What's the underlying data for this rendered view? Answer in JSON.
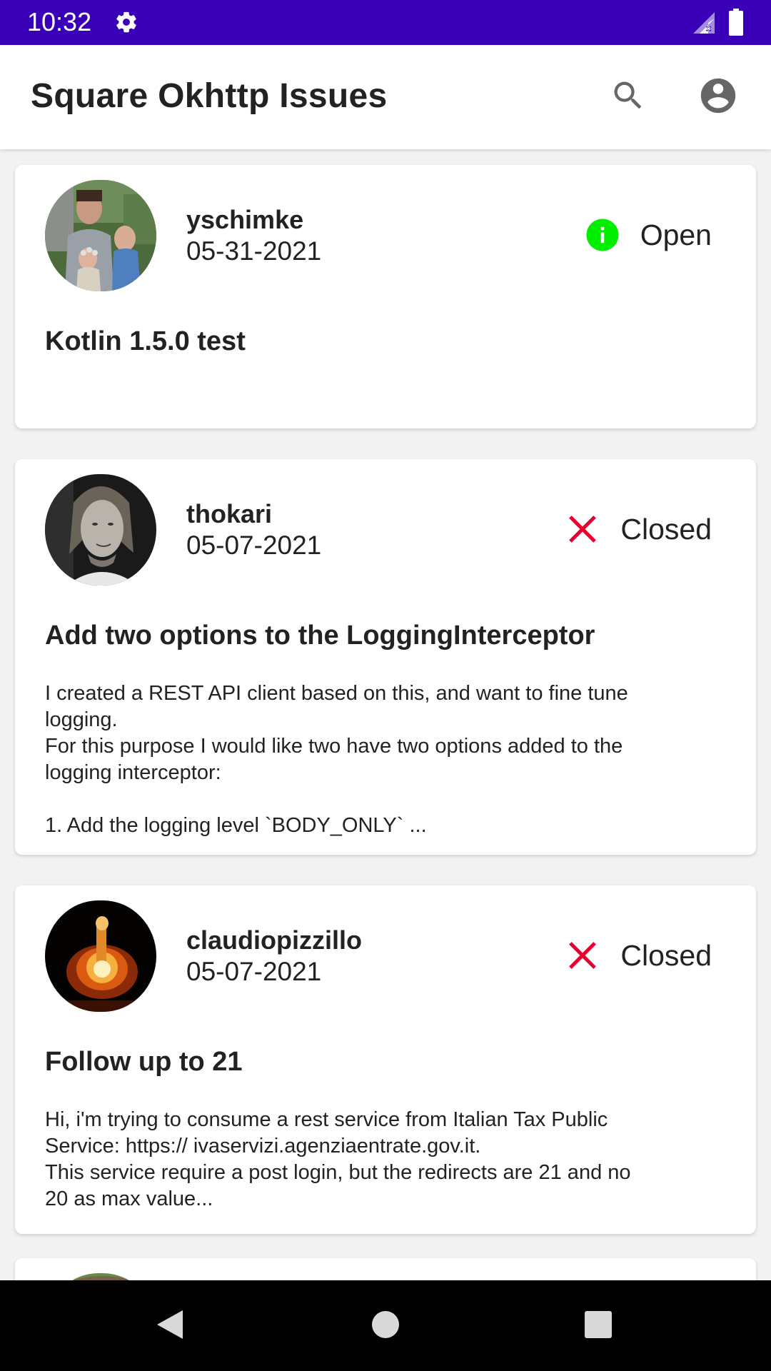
{
  "status_bar": {
    "time": "10:32",
    "icons": [
      "settings-gear-icon",
      "signal-icon",
      "battery-icon"
    ]
  },
  "app_bar": {
    "title": "Square Okhttp Issues",
    "actions": [
      "search-icon",
      "account-circle-icon"
    ]
  },
  "colors": {
    "status_bar": "#3a00b8",
    "open": "#00ee00",
    "closed": "#e8002a",
    "text": "#222222"
  },
  "issues": [
    {
      "user": "yschimke",
      "date": "05-31-2021",
      "status": "Open",
      "status_icon": "info-circle-icon",
      "title": "Kotlin 1.5.0 test",
      "body": ""
    },
    {
      "user": "thokari",
      "date": "05-07-2021",
      "status": "Closed",
      "status_icon": "close-x-icon",
      "title": "Add two options to the LoggingInterceptor",
      "body": "I created a REST API client based on this, and want to fine tune\nlogging.\nFor this purpose I would like two have two options added to the\nlogging interceptor:\n\n1. Add the logging level `BODY_ONLY` ..."
    },
    {
      "user": "claudiopizzillo",
      "date": "05-07-2021",
      "status": "Closed",
      "status_icon": "close-x-icon",
      "title": "Follow up to 21",
      "body": "Hi, i'm trying to consume a rest service from Italian Tax Public\nService: https:// ivaservizi.agenziaentrate.gov.it.\nThis service require a post login, but the redirects are 21 and no\n20 as max value..."
    }
  ],
  "nav_bar": {
    "buttons": [
      "back-icon",
      "home-icon",
      "recents-icon"
    ]
  }
}
